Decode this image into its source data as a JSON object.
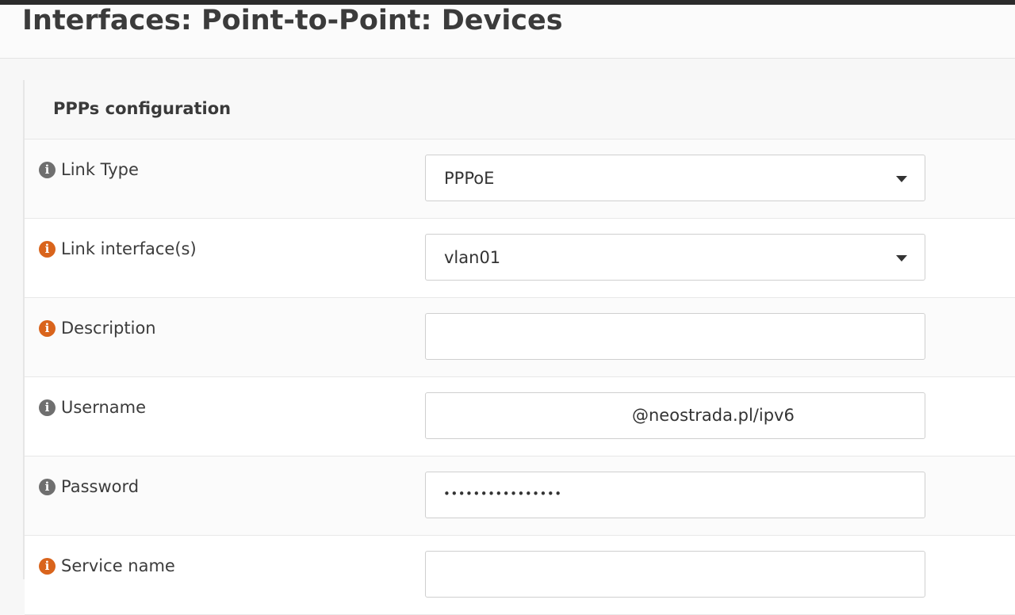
{
  "header": {
    "title": "Interfaces: Point-to-Point: Devices"
  },
  "panel": {
    "title": "PPPs configuration"
  },
  "fields": {
    "link_type": {
      "label": "Link Type",
      "value": "PPPoE",
      "icon": "info-icon",
      "icon_color": "#6f6f6f"
    },
    "link_interfaces": {
      "label": "Link interface(s)",
      "value": "vlan01",
      "icon": "info-icon",
      "icon_color": "#d9641c"
    },
    "description": {
      "label": "Description",
      "value": "",
      "icon": "info-icon",
      "icon_color": "#d9641c"
    },
    "username": {
      "label": "Username",
      "value": "@neostrada.pl/ipv6",
      "icon": "info-icon",
      "icon_color": "#6f6f6f"
    },
    "password": {
      "label": "Password",
      "value": "••••••••••••••••",
      "icon": "info-icon",
      "icon_color": "#6f6f6f"
    },
    "service_name": {
      "label": "Service name",
      "icon": "info-icon",
      "icon_color": "#d9641c"
    }
  },
  "icons": {
    "info_glyph": "i"
  }
}
